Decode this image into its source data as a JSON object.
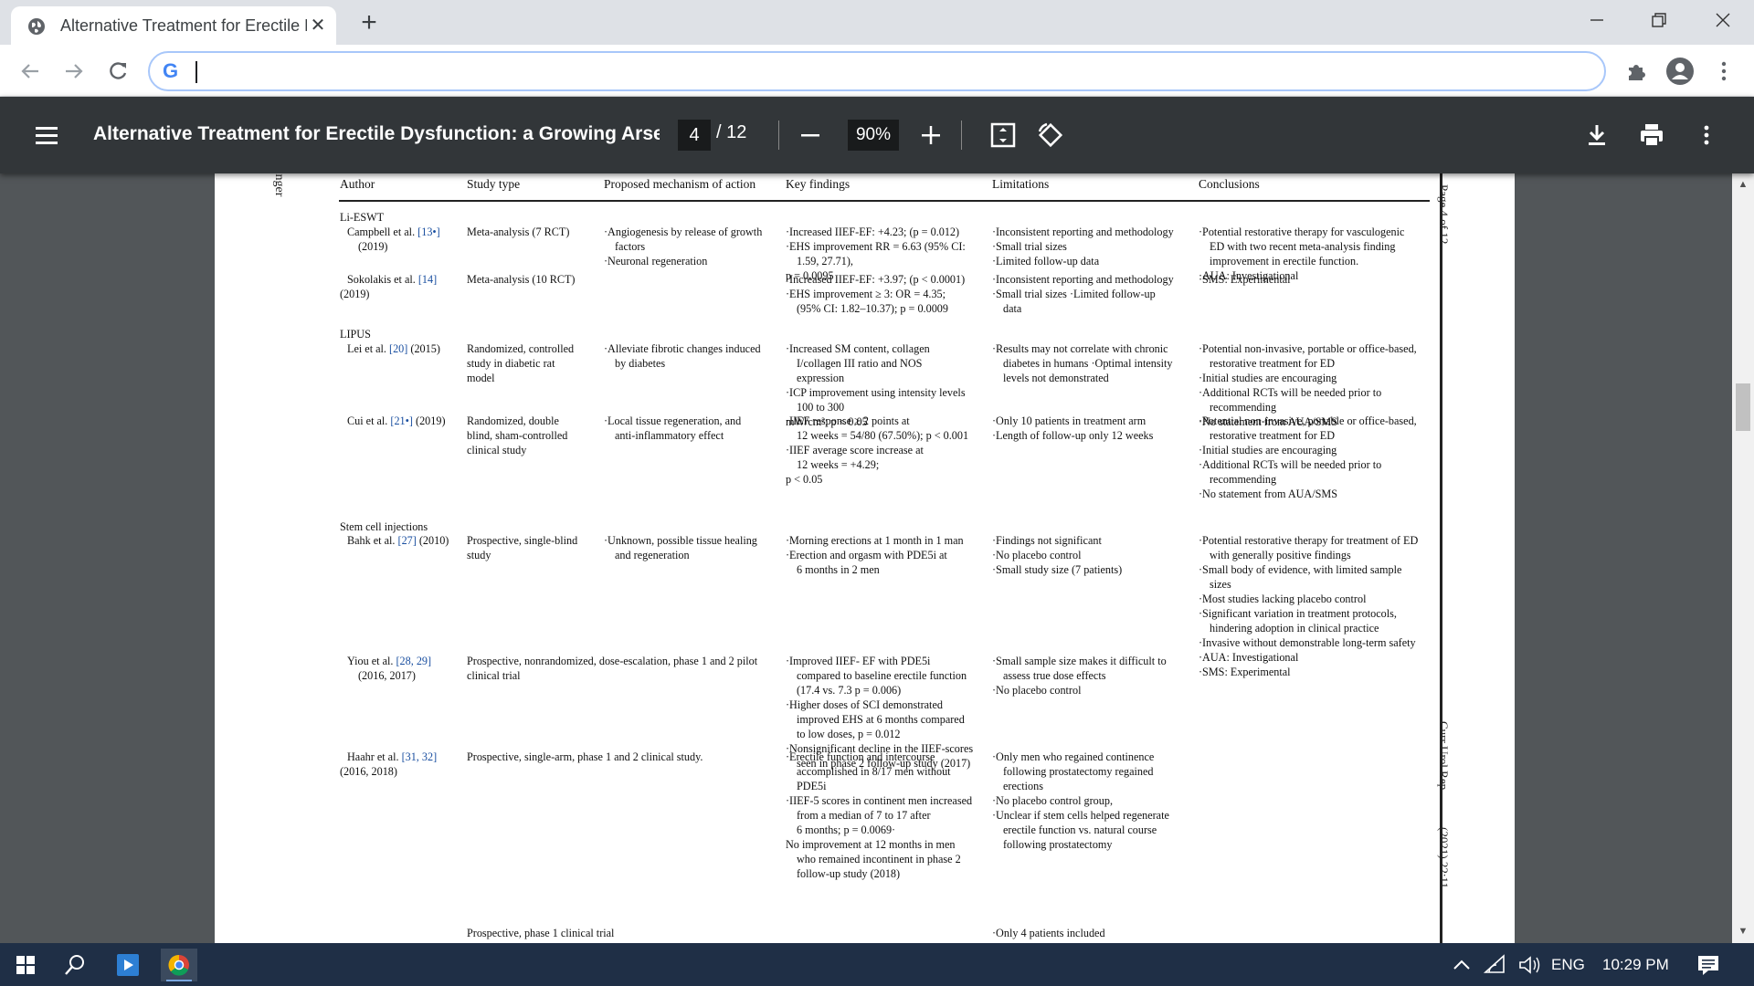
{
  "browser": {
    "tab_title": "Alternative Treatment for Erectile Dysfunction: a Growing Arsenal",
    "omnibox_value": ""
  },
  "pdf": {
    "title": "Alternative Treatment for Erectile Dysfunction: a Growing Arsen...",
    "page_current": "4",
    "page_total": "/ 12",
    "zoom": "90%",
    "publisher_edge": "ringer",
    "side_page": "Page 4 of 12",
    "side_journal": "Curr Urol Rep",
    "side_volume": "(2021) 22:11"
  },
  "table": {
    "headers": [
      "Author",
      "Study type",
      "Proposed mechanism of action",
      "Key findings",
      "Limitations",
      "Conclusions"
    ],
    "groups": {
      "li_eswt": "Li-ESWT",
      "lipus": "LIPUS",
      "stem": "Stem cell injections"
    },
    "rows": [
      {
        "author": [
          "Campbell et al. [13•]",
          "(2019)"
        ],
        "study": [
          "Meta-analysis (7 RCT)"
        ],
        "mechanism": [
          "·Angiogenesis by release of growth",
          "factors",
          "·Neuronal regeneration"
        ],
        "findings": [
          "·Increased IIEF-EF: +4.23; (p = 0.012)",
          "·EHS improvement RR = 6.63 (95% CI:",
          "1.59, 27.71),",
          "p = 0.0095"
        ],
        "limitations": [
          "·Inconsistent reporting and methodology",
          "·Small trial sizes",
          "·Limited follow-up data"
        ],
        "conclusions": [
          "·Potential restorative therapy for vasculogenic",
          "ED with two recent meta-analysis finding",
          "improvement in erectile function.",
          "·AUA: Investigational"
        ]
      },
      {
        "author": [
          "Sokolakis et al. [14]",
          "(2019)"
        ],
        "study": [
          "Meta-analysis (10 RCT)"
        ],
        "mechanism": [],
        "findings": [
          "·Increased IIEF-EF: +3.97; (p < 0.0001)",
          "·EHS improvement ≥ 3: OR = 4.35;",
          "(95% CI: 1.82–10.37); p = 0.0009"
        ],
        "limitations": [
          "·Inconsistent reporting and methodology",
          "·Small trial sizes ·Limited follow-up",
          "data"
        ],
        "conclusions": [
          "·SMS: Experimental"
        ]
      },
      {
        "author": [
          "Lei et al. [20] (2015)"
        ],
        "study": [
          "Randomized, controlled",
          "study in diabetic rat",
          "model"
        ],
        "mechanism": [
          "·Alleviate fibrotic changes induced",
          "by diabetes"
        ],
        "findings": [
          "·Increased SM content, collagen",
          "I/collagen III ratio and NOS",
          "expression",
          "·ICP improvement using intensity levels",
          "100 to 300",
          "mW/cm²; p < 0.05"
        ],
        "limitations": [
          "·Results may not correlate with chronic",
          "diabetes in humans ·Optimal intensity",
          "levels not demonstrated"
        ],
        "conclusions": [
          "·Potential non-invasive, portable or office-based,",
          "restorative treatment for ED",
          "·Initial studies are encouraging",
          "·Additional RCTs will be needed prior to",
          "recommending",
          "·No statement from AUA/SMS"
        ]
      },
      {
        "author": [
          "Cui et al. [21•] (2019)"
        ],
        "study": [
          "Randomized, double",
          "blind, sham-controlled",
          "clinical study"
        ],
        "mechanism": [
          "·Local tissue regeneration, and",
          "anti-inflammatory effect"
        ],
        "findings": [
          "·IIEF response ≥ 2 points at",
          "12 weeks = 54/80 (67.50%); p < 0.001",
          "·IIEF average score increase at",
          "12 weeks = +4.29;",
          "p < 0.05"
        ],
        "limitations": [
          "·Only 10 patients in treatment arm",
          "·Length of follow-up only 12 weeks"
        ],
        "conclusions": [
          "·Potential non-invasive, portable or office-based,",
          "restorative treatment for ED",
          "·Initial studies are encouraging",
          "·Additional RCTs will be needed prior to",
          "recommending",
          "·No statement from AUA/SMS"
        ]
      },
      {
        "author": [
          "Bahk et al. [27] (2010)"
        ],
        "study": [
          "Prospective, single-blind",
          "study"
        ],
        "mechanism": [
          "·Unknown, possible tissue healing",
          "and regeneration"
        ],
        "findings": [
          "·Morning erections at 1 month in 1 man",
          "·Erection and orgasm with PDE5i at",
          "6 months in 2 men"
        ],
        "limitations": [
          "·Findings not significant",
          "·No placebo control",
          "·Small study size (7 patients)"
        ],
        "conclusions": [
          "·Potential restorative therapy for treatment of ED",
          "with generally positive findings",
          "·Small body of evidence, with limited sample",
          "sizes",
          "·Most studies lacking placebo control",
          "·Significant variation in treatment protocols,",
          "hindering adoption in clinical practice",
          "·Invasive without demonstrable long-term safety",
          "·AUA: Investigational",
          "·SMS: Experimental"
        ]
      },
      {
        "author": [
          "Yiou et al. [28, 29]",
          "(2016, 2017)"
        ],
        "study": [
          "Prospective, nonrandomized, dose-escalation, phase 1 and 2 pilot",
          "clinical trial"
        ],
        "mechanism": [],
        "findings": [
          "·Improved IIEF- EF with PDE5i",
          "compared to baseline erectile function",
          "(17.4 vs. 7.3 p = 0.006)",
          "·Higher doses of SCI demonstrated",
          "improved EHS at 6 months compared",
          "to low doses, p = 0.012",
          "·Nonsignificant decline in the IIEF-scores",
          "seen in phase 2 follow-up study (2017)"
        ],
        "limitations": [
          "·Small sample size makes it difficult to",
          "assess true dose effects",
          "·No placebo control"
        ],
        "conclusions": []
      },
      {
        "author": [
          "Haahr et al. [31, 32]",
          "(2016, 2018)"
        ],
        "study": [
          "Prospective, single-arm, phase 1 and 2 clinical study."
        ],
        "mechanism": [],
        "findings": [
          "·Erectile function and intercourse",
          "accomplished in 8/17 men without",
          "PDE5i",
          "·IIEF-5 scores in continent men increased",
          "from a median of 7 to 17 after",
          "6 months; p = 0.0069·",
          "No improvement at 12 months in men",
          "who remained incontinent in phase 2",
          "follow-up study (2018)"
        ],
        "limitations": [
          "·Only men who regained continence",
          "following prostatectomy regained",
          "erections",
          "·No placebo control group,",
          "·Unclear if stem cells helped regenerate",
          "erectile function vs. natural course",
          "following prostatectomy"
        ],
        "conclusions": []
      },
      {
        "author": [],
        "study": [
          "Prospective, phase 1 clinical trial"
        ],
        "mechanism": [],
        "findings": [],
        "limitations": [
          "·Only 4 patients included"
        ],
        "conclusions": []
      }
    ]
  },
  "taskbar": {
    "language": "ENG",
    "time": "10:29 PM"
  }
}
